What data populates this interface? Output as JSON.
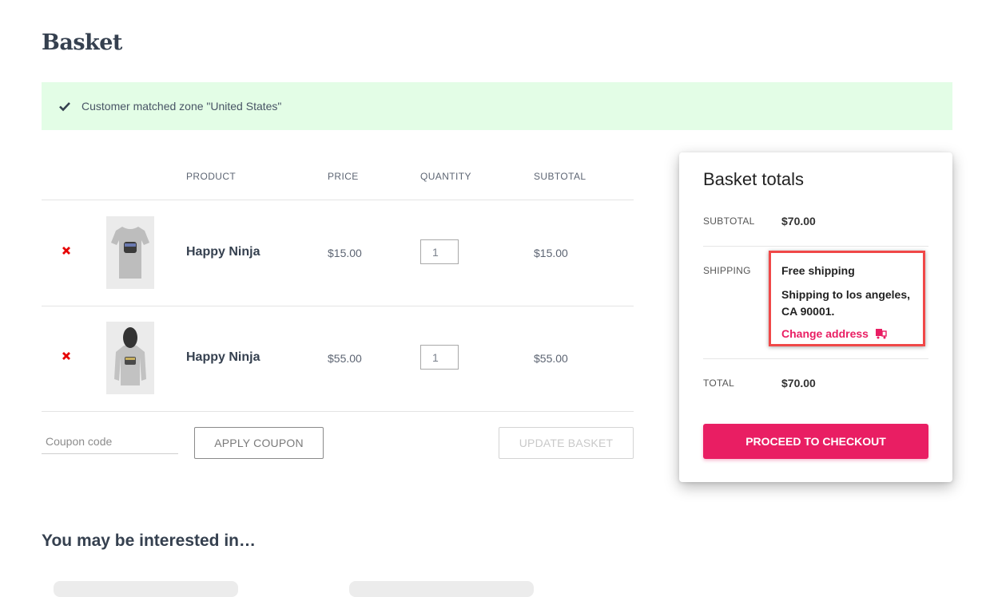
{
  "page": {
    "title": "Basket"
  },
  "notice": {
    "icon": "check-icon",
    "message": "Customer matched zone \"United States\"",
    "background": "#e3fde6"
  },
  "cart": {
    "columns": [
      "",
      "",
      "PRODUCT",
      "PRICE",
      "QUANTITY",
      "SUBTOTAL"
    ],
    "items": [
      {
        "name": "Happy Ninja",
        "image": "t-shirt",
        "price": "$15.00",
        "quantity": "1",
        "subtotal": "$15.00"
      },
      {
        "name": "Happy Ninja",
        "image": "hoodie",
        "price": "$55.00",
        "quantity": "1",
        "subtotal": "$55.00"
      }
    ],
    "coupon_placeholder": "Coupon code",
    "apply_coupon_label": "APPLY COUPON",
    "update_basket_label": "UPDATE BASKET"
  },
  "totals": {
    "title": "Basket totals",
    "subtotal_label": "SUBTOTAL",
    "subtotal_value": "$70.00",
    "shipping_label": "SHIPPING",
    "shipping_method": "Free shipping",
    "shipping_destination": "Shipping to los angeles, CA 90001.",
    "change_address_label": "Change address",
    "total_label": "TOTAL",
    "total_value": "$70.00",
    "checkout_label": "PROCEED TO CHECKOUT",
    "accent_color": "#e91e63",
    "highlight_color": "#f04848"
  },
  "related": {
    "title": "You may be interested in…"
  }
}
